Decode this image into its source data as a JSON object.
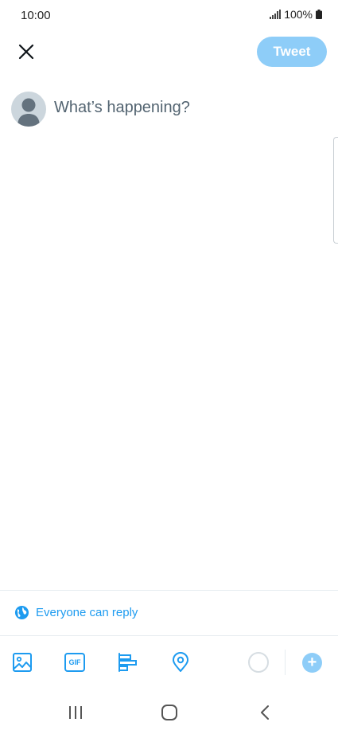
{
  "status_bar": {
    "time": "10:00",
    "battery_text": "100%",
    "icons": [
      "signal-icon",
      "battery-icon"
    ]
  },
  "header": {
    "close_icon": "close-icon",
    "tweet_label": "Tweet"
  },
  "compose": {
    "placeholder": "What’s happening?",
    "avatar_icon": "default-avatar-icon"
  },
  "reply_settings": {
    "label": "Everyone can reply",
    "icon": "globe-icon"
  },
  "toolbar": {
    "tools": [
      "image-icon",
      "gif-icon",
      "poll-icon",
      "location-icon"
    ],
    "gif_label": "GIF",
    "add_label": "+"
  },
  "nav": {
    "buttons": [
      "recent-apps-icon",
      "home-icon",
      "back-icon"
    ]
  },
  "colors": {
    "accent": "#1d9bf0",
    "tweet_button_disabled": "#8ecdf8",
    "placeholder": "#536471",
    "divider": "#e6ecf0"
  }
}
